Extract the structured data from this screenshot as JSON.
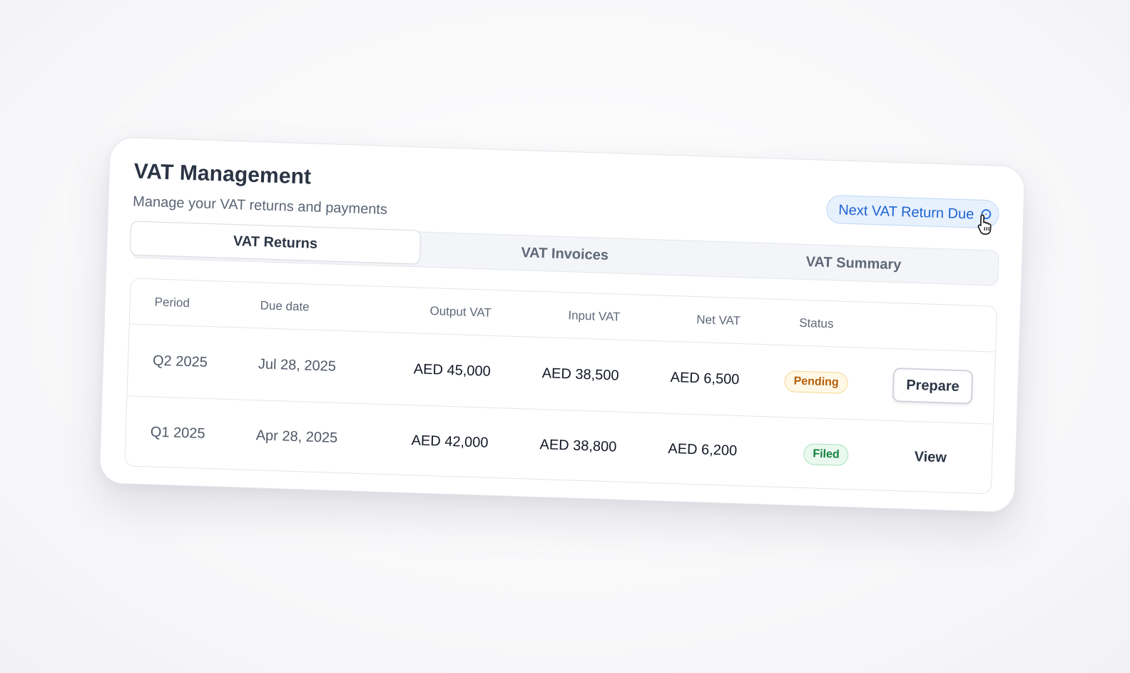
{
  "header": {
    "title": "VAT Management",
    "subtitle": "Manage your VAT returns and payments",
    "due_chip_label": "Next VAT Return Due"
  },
  "tabs": [
    {
      "label": "VAT Returns",
      "active": true
    },
    {
      "label": "VAT Invoices",
      "active": false
    },
    {
      "label": "VAT Summary",
      "active": false
    }
  ],
  "table": {
    "columns": [
      "Period",
      "Due date",
      "Output VAT",
      "Input VAT",
      "Net VAT",
      "Status"
    ],
    "rows": [
      {
        "period": "Q2 2025",
        "due_date": "Jul 28, 2025",
        "output_vat": "AED 45,000",
        "input_vat": "AED 38,500",
        "net_vat": "AED 6,500",
        "status": "Pending",
        "action": "Prepare"
      },
      {
        "period": "Q1 2025",
        "due_date": "Apr 28, 2025",
        "output_vat": "AED 42,000",
        "input_vat": "AED 38,800",
        "net_vat": "AED 6,200",
        "status": "Filed",
        "action": "View"
      }
    ]
  },
  "colors": {
    "accent": "#1e63cf",
    "pending": "#b45d0a",
    "filed": "#15803d"
  },
  "icons": [
    "info-icon",
    "pointer-cursor-icon"
  ]
}
